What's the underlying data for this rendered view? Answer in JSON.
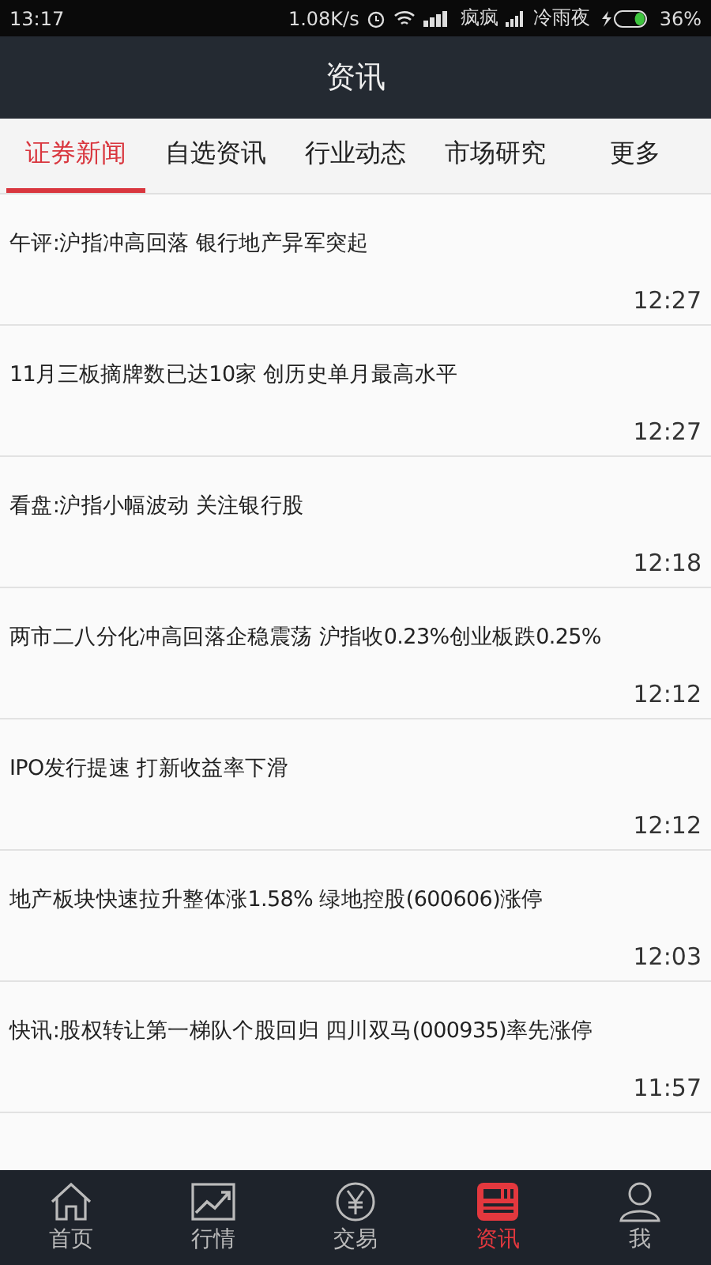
{
  "status_bar": {
    "time": "13:17",
    "speed": "1.08K/s",
    "carrier_1": "疯疯",
    "carrier_2": "冷雨夜",
    "battery": "36%"
  },
  "header": {
    "title": "资讯"
  },
  "tabs": [
    {
      "label": "证券新闻",
      "selected": true
    },
    {
      "label": "自选资讯",
      "selected": false
    },
    {
      "label": "行业动态",
      "selected": false
    },
    {
      "label": "市场研究",
      "selected": false
    },
    {
      "label": "更多",
      "selected": false
    }
  ],
  "news": [
    {
      "title": "午评:沪指冲高回落 银行地产异军突起",
      "time": "12:27"
    },
    {
      "title": "11月三板摘牌数已达10家 创历史单月最高水平",
      "time": "12:27"
    },
    {
      "title": "看盘:沪指小幅波动 关注银行股",
      "time": "12:18"
    },
    {
      "title": "两市二八分化冲高回落企稳震荡 沪指收0.23%创业板跌0.25%",
      "time": "12:12"
    },
    {
      "title": "IPO发行提速 打新收益率下滑",
      "time": "12:12"
    },
    {
      "title": "地产板块快速拉升整体涨1.58% 绿地控股(600606)涨停",
      "time": "12:03"
    },
    {
      "title": "快讯:股权转让第一梯队个股回归 四川双马(000935)率先涨停",
      "time": "11:57"
    }
  ],
  "bottom_nav": [
    {
      "kind": "home",
      "label": "首页",
      "selected": false
    },
    {
      "kind": "chart",
      "label": "行情",
      "selected": false
    },
    {
      "kind": "trade",
      "label": "交易",
      "selected": false
    },
    {
      "kind": "news",
      "label": "资讯",
      "selected": true
    },
    {
      "kind": "profile",
      "label": "我",
      "selected": false
    }
  ]
}
